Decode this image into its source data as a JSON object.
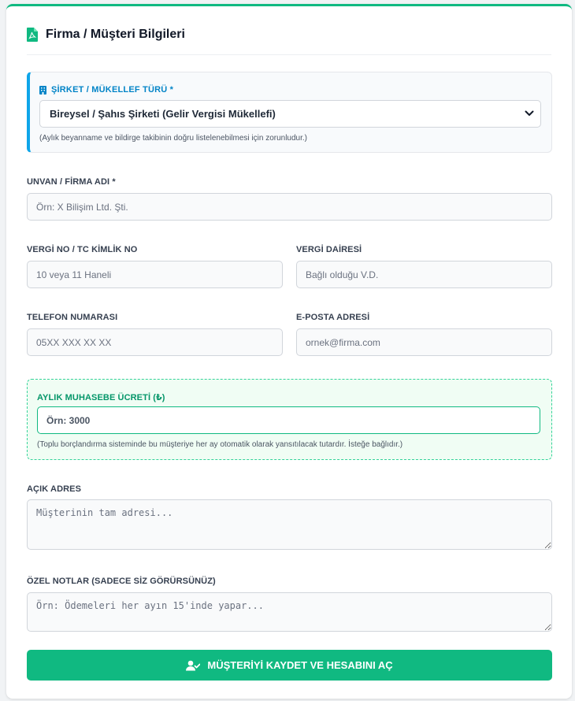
{
  "header": {
    "title": "Firma / Müşteri Bilgileri",
    "icon": "file-pdf-icon"
  },
  "company_type": {
    "label": "ŞİRKET / MÜKELLEF TÜRÜ *",
    "icon": "building-icon",
    "selected": "Bireysel / Şahıs Şirketi (Gelir Vergisi Mükellefi)",
    "hint": "(Aylık beyanname ve bildirge takibinin doğru listelenebilmesi için zorunludur.)"
  },
  "title_field": {
    "label": "UNVAN / FİRMA ADI *",
    "placeholder": "Örn: X Bilişim Ltd. Şti."
  },
  "tax_no": {
    "label": "VERGİ NO / TC KİMLİK NO",
    "placeholder": "10 veya 11 Haneli"
  },
  "tax_office": {
    "label": "VERGİ DAİRESİ",
    "placeholder": "Bağlı olduğu V.D."
  },
  "phone": {
    "label": "TELEFON NUMARASI",
    "placeholder": "05XX XXX XX XX"
  },
  "email": {
    "label": "E-POSTA ADRESİ",
    "placeholder": "ornek@firma.com"
  },
  "monthly_fee": {
    "label": "AYLIK MUHASEBE ÜCRETİ (₺)",
    "placeholder": "Örn: 3000",
    "hint": "(Toplu borçlandırma sisteminde bu müşteriye her ay otomatik olarak yansıtılacak tutardır. İsteğe bağlıdır.)"
  },
  "address": {
    "label": "AÇIK ADRES",
    "placeholder": "Müşterinin tam adresi..."
  },
  "notes": {
    "label": "ÖZEL NOTLAR (SADECE SİZ GÖRÜRSÜNÜZ)",
    "placeholder": "Örn: Ödemeleri her ayın 15'inde yapar..."
  },
  "submit": {
    "label": "MÜŞTERİYİ KAYDET VE HESABINI AÇ",
    "icon": "user-check-icon"
  },
  "colors": {
    "accent": "#10b981",
    "info": "#0ea5e9",
    "info_text": "#0284c7",
    "fee_text": "#059669"
  }
}
